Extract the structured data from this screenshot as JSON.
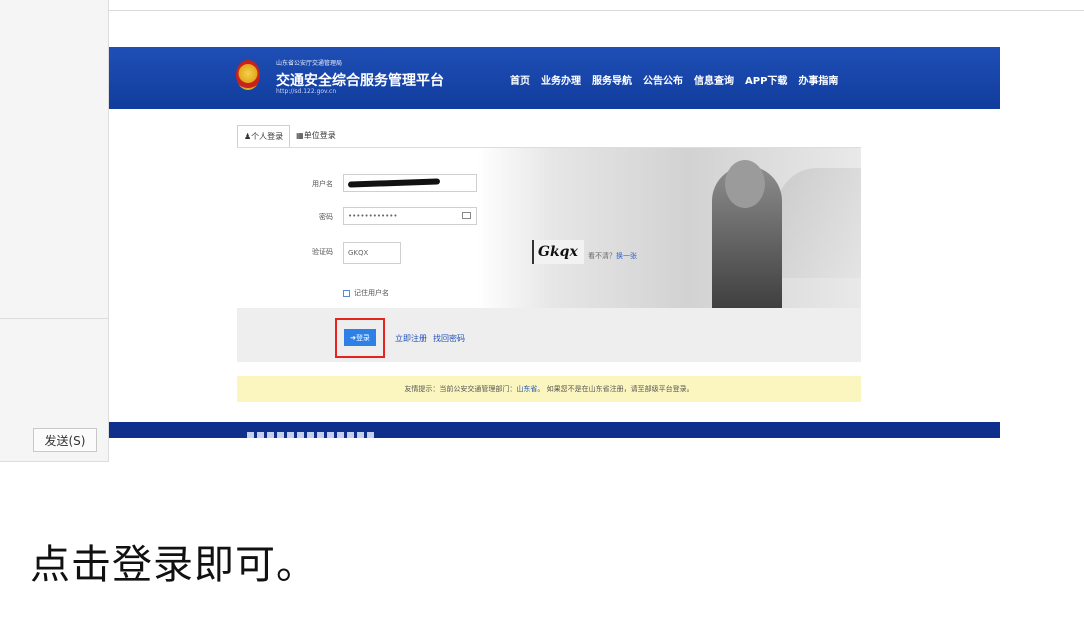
{
  "chat": {
    "send_label": "发送(S)"
  },
  "site": {
    "org_small": "山东省公安厅交通管理局",
    "title": "交通安全综合服务管理平台",
    "url": "http://sd.122.gov.cn",
    "nav": [
      "首页",
      "业务办理",
      "服务导航",
      "公告公布",
      "信息查询",
      "APP下载",
      "办事指南"
    ]
  },
  "login": {
    "tabs": [
      "个人登录",
      "单位登录"
    ],
    "username_label": "用户名",
    "password_label": "密码",
    "password_value": "••••••••••••",
    "captcha_label": "验证码",
    "captcha_input_value": "GKQX",
    "captcha_image_text": "Gkqx",
    "captcha_hint": "看不清？",
    "captcha_refresh": "换一张",
    "remember_label": "记住用户名",
    "login_button": "登录",
    "register_link": "立即注册",
    "recover_link": "找回密码"
  },
  "tip": {
    "prefix": "友情提示：当前公安交通管理部门：",
    "province": "山东省",
    "suffix": "。 如果您不是在山东省注册，请至部级平台登录。"
  },
  "caption": "点击登录即可。",
  "colors": {
    "header_blue": "#1f4fb6",
    "button_blue": "#2f80e6",
    "highlight_red": "#e52420",
    "tip_yellow": "#fbf6c0"
  }
}
